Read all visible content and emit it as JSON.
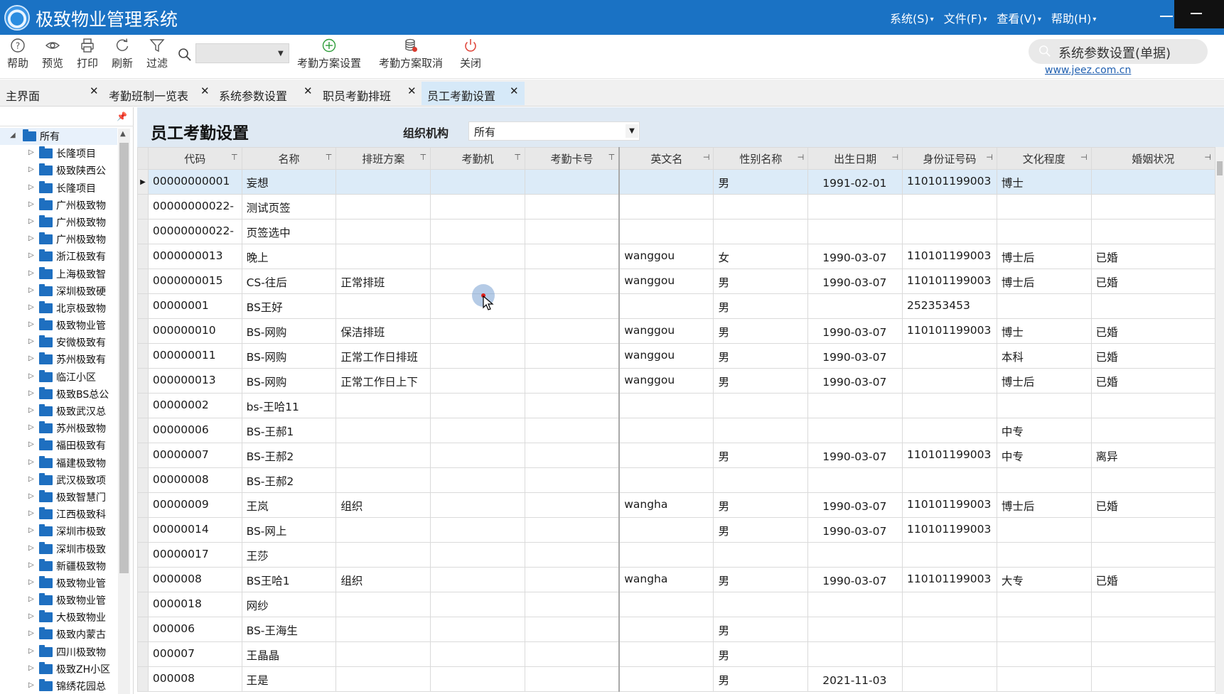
{
  "app": {
    "title": "极致物业管理系统",
    "menus": [
      "系统(S)",
      "文件(F)",
      "查看(V)",
      "帮助(H)"
    ]
  },
  "toolbar": {
    "help": "帮助",
    "preview": "预览",
    "print": "打印",
    "refresh": "刷新",
    "filter": "过滤",
    "scheme_set": "考勤方案设置",
    "scheme_cancel": "考勤方案取消",
    "close": "关闭",
    "quick_search": "系统参数设置(单据)",
    "website": "www.jeez.com.cn"
  },
  "tabs": [
    "主界面",
    "考勤班制一览表",
    "系统参数设置",
    "职员考勤排班",
    "员工考勤设置"
  ],
  "tree": {
    "root": "所有",
    "items": [
      "长隆项目",
      "极致陕西公",
      "长隆项目",
      "广州极致物",
      "广州极致物",
      "广州极致物",
      "浙江极致有",
      "上海极致智",
      "深圳极致硬",
      "北京极致物",
      "极致物业管",
      "安微极致有",
      "苏州极致有",
      "临江小区",
      "极致BS总公",
      "极致武汉总",
      "苏州极致物",
      "福田极致有",
      "福建极致物",
      "武汉极致项",
      "极致智慧门",
      "江西极致科",
      "深圳市极致",
      "深圳市极致",
      "新疆极致物",
      "极致物业管",
      "极致物业管",
      "大极致物业",
      "极致内蒙古",
      "四川极致物",
      "极致ZH小区",
      "锦绣花园总"
    ]
  },
  "main": {
    "page_title": "员工考勤设置",
    "org_label": "组织机构",
    "org_value": "所有"
  },
  "grid": {
    "columns": [
      "代码",
      "名称",
      "排班方案",
      "考勤机",
      "考勤卡号",
      "英文名",
      "性别名称",
      "出生日期",
      "身份证号码",
      "文化程度",
      "婚姻状况"
    ],
    "rows": [
      [
        "00000000001",
        "妄想",
        "",
        "",
        "",
        "",
        "男",
        "1991-02-01",
        "110101199003",
        "博士",
        ""
      ],
      [
        "00000000022-",
        "测试页签",
        "",
        "",
        "",
        "",
        "",
        "",
        "",
        "",
        ""
      ],
      [
        "00000000022-",
        "页签选中",
        "",
        "",
        "",
        "",
        "",
        "",
        "",
        "",
        ""
      ],
      [
        "0000000013",
        "晚上",
        "",
        "",
        "",
        "wanggou",
        "女",
        "1990-03-07",
        "110101199003",
        "博士后",
        "已婚"
      ],
      [
        "0000000015",
        "CS-往后",
        "正常排班",
        "",
        "",
        "wanggou",
        "男",
        "1990-03-07",
        "110101199003",
        "博士后",
        "已婚"
      ],
      [
        "00000001",
        "BS王好",
        "",
        "",
        "",
        "",
        "男",
        "",
        "252353453",
        "",
        ""
      ],
      [
        "000000010",
        "BS-网购",
        "保洁排班",
        "",
        "",
        "wanggou",
        "男",
        "1990-03-07",
        "110101199003",
        "博士",
        "已婚"
      ],
      [
        "000000011",
        "BS-网购",
        "正常工作日排班",
        "",
        "",
        "wanggou",
        "男",
        "1990-03-07",
        "",
        "本科",
        "已婚"
      ],
      [
        "000000013",
        "BS-网购",
        "正常工作日上下",
        "",
        "",
        "wanggou",
        "男",
        "1990-03-07",
        "",
        "博士后",
        "已婚"
      ],
      [
        "00000002",
        "bs-王哈11",
        "",
        "",
        "",
        "",
        "",
        "",
        "",
        "",
        ""
      ],
      [
        "00000006",
        "BS-王郝1",
        "",
        "",
        "",
        "",
        "",
        "",
        "",
        "中专",
        ""
      ],
      [
        "00000007",
        "BS-王郝2",
        "",
        "",
        "",
        "",
        "男",
        "1990-03-07",
        "110101199003",
        "中专",
        "离异"
      ],
      [
        "00000008",
        "BS-王郝2",
        "",
        "",
        "",
        "",
        "",
        "",
        "",
        "",
        ""
      ],
      [
        "00000009",
        "王岚",
        "组织",
        "",
        "",
        "wangha",
        "男",
        "1990-03-07",
        "110101199003",
        "博士后",
        "已婚"
      ],
      [
        "00000014",
        "BS-网上",
        "",
        "",
        "",
        "",
        "男",
        "1990-03-07",
        "110101199003",
        "",
        ""
      ],
      [
        "00000017",
        "王莎",
        "",
        "",
        "",
        "",
        "",
        "",
        "",
        "",
        ""
      ],
      [
        "0000008",
        "BS王哈1",
        "组织",
        "",
        "",
        "wangha",
        "男",
        "1990-03-07",
        "110101199003",
        "大专",
        "已婚"
      ],
      [
        "0000018",
        "网纱",
        "",
        "",
        "",
        "",
        "",
        "",
        "",
        "",
        ""
      ],
      [
        "000006",
        "BS-王海生",
        "",
        "",
        "",
        "",
        "男",
        "",
        "",
        "",
        ""
      ],
      [
        "000007",
        "王晶晶",
        "",
        "",
        "",
        "",
        "男",
        "",
        "",
        "",
        ""
      ],
      [
        "000008",
        "王是",
        "",
        "",
        "",
        "",
        "男",
        "2021-11-03",
        "",
        "",
        ""
      ]
    ]
  },
  "colors": {
    "titlebar": "#1a72c4",
    "active_tab": "#d6e9f8",
    "main_bg": "#dfe9f3",
    "selected_row": "#dcebf8",
    "folder": "#1e6fc0"
  }
}
